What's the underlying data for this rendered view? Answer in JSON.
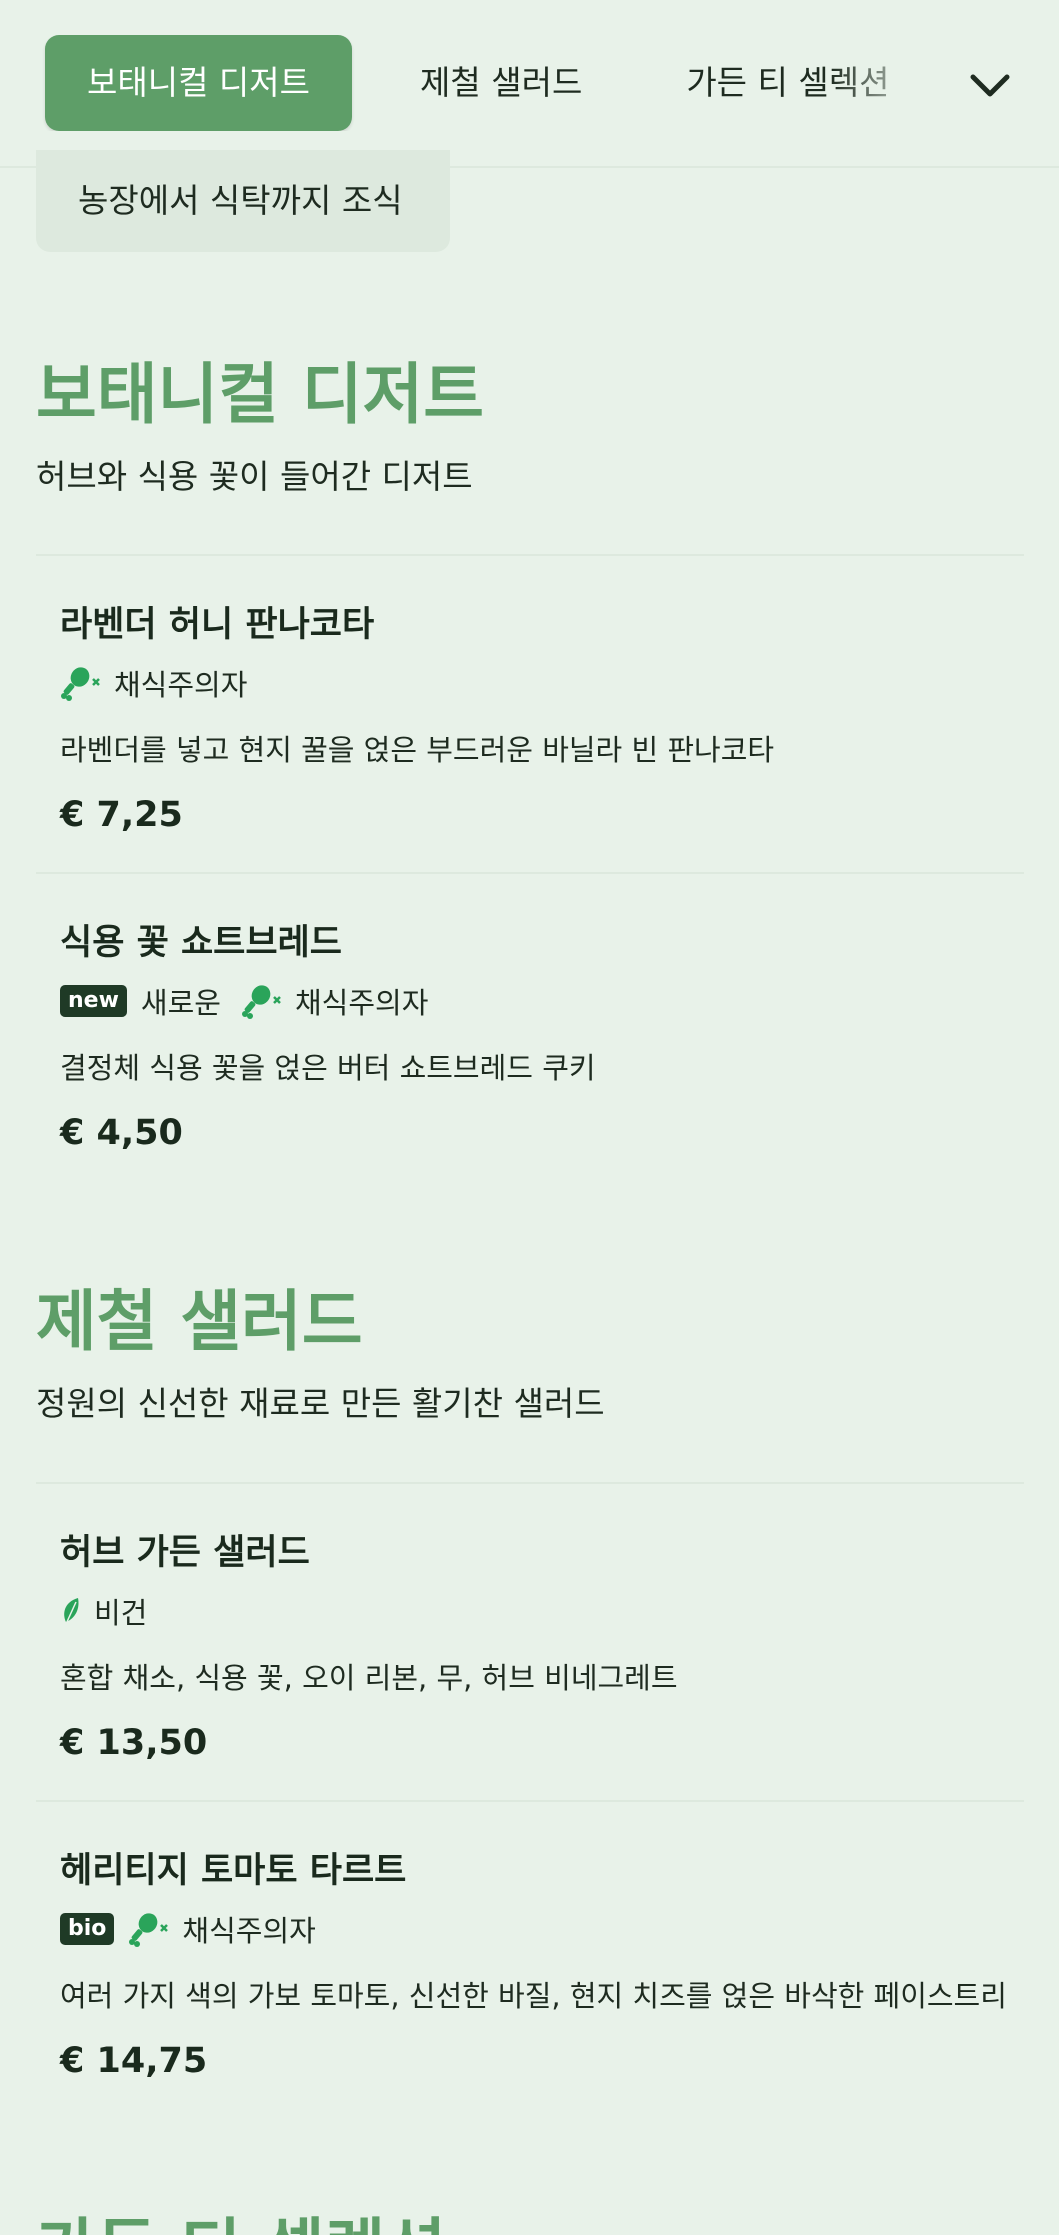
{
  "nav": {
    "tabs": [
      "보태니컬 디저트",
      "제철 샐러드",
      "가든 티 셀렉션"
    ],
    "menu_icon": "chevron-down-icon"
  },
  "chip": {
    "label": "농장에서 식탁까지 조식"
  },
  "sections": [
    {
      "title": "보태니컬 디저트",
      "description": "허브와 식용 꽃이 들어간 디저트",
      "items": [
        {
          "name": "라벤더 허니 판나코타",
          "tags": [
            "채식주의자"
          ],
          "description": "라벤더를 넣고 현지 꿀을 얹은 부드러운 바닐라 빈 판나코타",
          "price": "€ 7,25"
        },
        {
          "name": "식용 꽃 쇼트브레드",
          "badge": "new",
          "badge_label": "새로운",
          "tags": [
            "채식주의자"
          ],
          "description": "결정체 식용 꽃을 얹은 버터 쇼트브레드 쿠키",
          "price": "€ 4,50"
        }
      ]
    },
    {
      "title": "제철 샐러드",
      "description": "정원의 신선한 재료로 만든 활기찬 샐러드",
      "items": [
        {
          "name": "허브 가든 샐러드",
          "tags": [
            "비건"
          ],
          "description": "혼합 채소, 식용 꽃, 오이 리본, 무, 허브 비네그레트",
          "price": "€ 13,50"
        },
        {
          "name": "헤리티지 토마토 타르트",
          "badge": "bio",
          "tags": [
            "채식주의자"
          ],
          "description": "여러 가지 색의 가보 토마토, 신선한 바질, 현지 치즈를 얹은 바삭한 페이스트리",
          "price": "€ 14,75"
        }
      ]
    },
    {
      "title": "가든 티 셀렉션"
    }
  ],
  "colors": {
    "accent": "#5e9e68",
    "background": "#e8f2e9",
    "badge": "#1f3a26",
    "icon": "#2aa45a"
  }
}
